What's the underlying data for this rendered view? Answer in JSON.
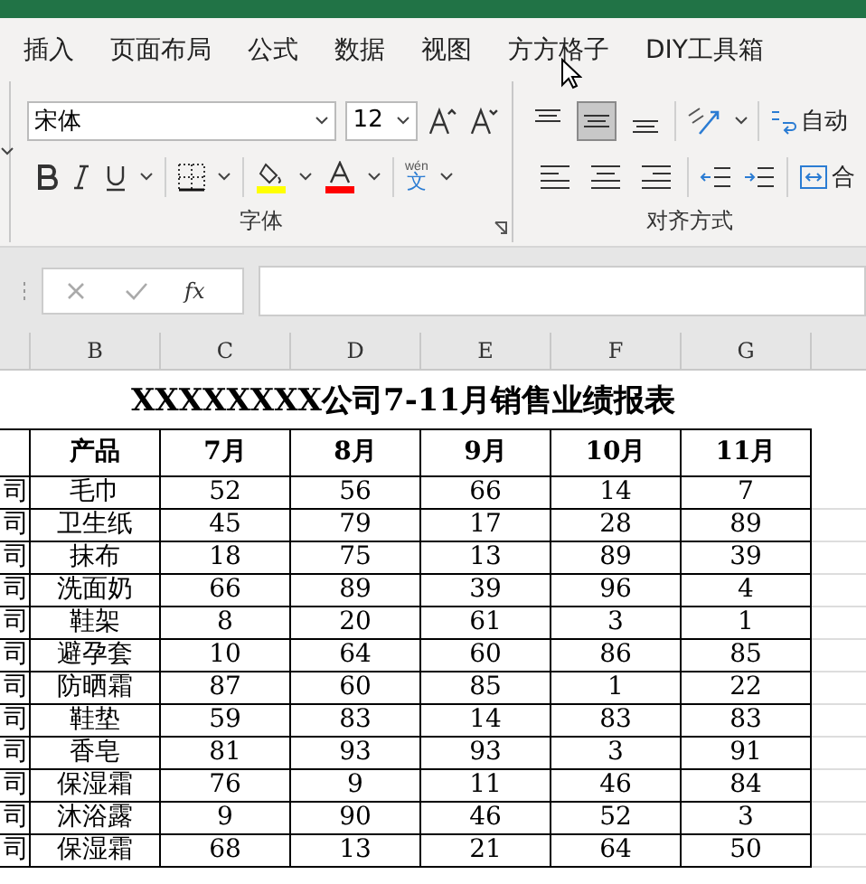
{
  "tabs": [
    {
      "label": "插入",
      "selected": false
    },
    {
      "label": "页面布局",
      "selected": false
    },
    {
      "label": "公式",
      "selected": false
    },
    {
      "label": "数据",
      "selected": false
    },
    {
      "label": "视图",
      "selected": false
    },
    {
      "label": "方方格子",
      "selected": false
    },
    {
      "label": "DIY工具箱",
      "selected": false
    }
  ],
  "font_group": {
    "font_name": "宋体",
    "font_size": "12",
    "phonetic_label": "wén",
    "phonetic_char": "文",
    "label": "字体"
  },
  "alignment_group": {
    "buttons": [
      {
        "kind": "top",
        "selected": false
      },
      {
        "kind": "middle",
        "selected": true
      },
      {
        "kind": "bottom",
        "selected": false
      }
    ],
    "horizontal": [
      {
        "kind": "left",
        "selected": false
      },
      {
        "kind": "center",
        "selected": false
      },
      {
        "kind": "right",
        "selected": false
      }
    ],
    "wrap_label": "自动",
    "merge_label": "合",
    "label": "对齐方式"
  },
  "formula_bar": {
    "function_label": "fx"
  },
  "columns": [
    "B",
    "C",
    "D",
    "E",
    "F",
    "G"
  ],
  "sheet": {
    "title": "XXXXXXXX公司7-11月销售业绩报表",
    "headers": [
      "产品",
      "7月",
      "8月",
      "9月",
      "10月",
      "11月"
    ],
    "rows": [
      {
        "column_1": "司",
        "product": "毛巾",
        "values": [
          "52",
          "56",
          "66",
          "14",
          "7"
        ]
      },
      {
        "column_1": "司",
        "product": "卫生纸",
        "values": [
          "45",
          "79",
          "17",
          "28",
          "89"
        ]
      },
      {
        "column_1": "司",
        "product": "抹布",
        "values": [
          "18",
          "75",
          "13",
          "89",
          "39"
        ]
      },
      {
        "column_1": "司",
        "product": "洗面奶",
        "values": [
          "66",
          "89",
          "39",
          "96",
          "4"
        ]
      },
      {
        "column_1": "司",
        "product": "鞋架",
        "values": [
          "8",
          "20",
          "61",
          "3",
          "1"
        ]
      },
      {
        "column_1": "司",
        "product": "避孕套",
        "values": [
          "10",
          "64",
          "60",
          "86",
          "85"
        ]
      },
      {
        "column_1": "司",
        "product": "防晒霜",
        "values": [
          "87",
          "60",
          "85",
          "1",
          "22"
        ]
      },
      {
        "column_1": "司",
        "product": "鞋垫",
        "values": [
          "59",
          "83",
          "14",
          "83",
          "83"
        ]
      },
      {
        "column_1": "司",
        "product": "香皂",
        "values": [
          "81",
          "93",
          "93",
          "3",
          "91"
        ]
      },
      {
        "column_1": "司",
        "product": "保湿霜",
        "values": [
          "76",
          "9",
          "11",
          "46",
          "84"
        ]
      },
      {
        "column_1": "司",
        "product": "沐浴露",
        "values": [
          "9",
          "90",
          "46",
          "52",
          "3"
        ]
      },
      {
        "column_1": "司",
        "product": "保湿霜",
        "values": [
          "68",
          "13",
          "21",
          "64",
          "50"
        ]
      }
    ]
  }
}
